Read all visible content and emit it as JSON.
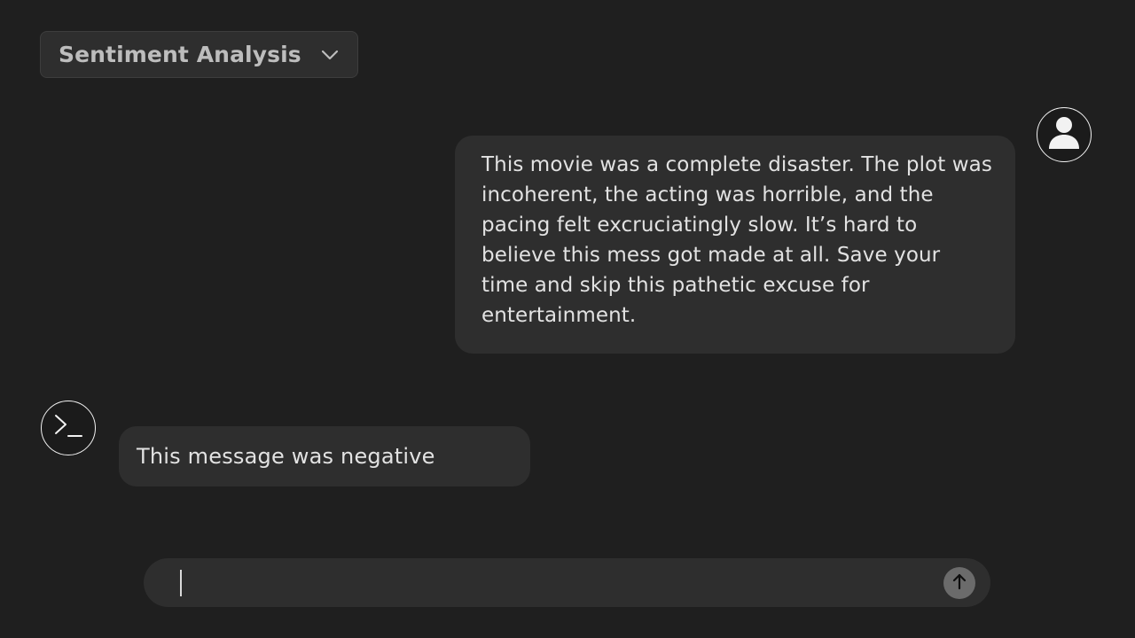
{
  "header": {
    "model_select": {
      "label": "Sentiment Analysis",
      "icon": "chevron-down-icon"
    }
  },
  "conversation": {
    "messages": [
      {
        "role": "user",
        "avatar_icon": "user-icon",
        "text": "This movie was a complete disaster. The plot was incoherent, the acting was horrible, and the pacing felt excruciatingly slow. It’s hard to believe this mess got made at all. Save your time and skip this pathetic excuse for entertainment."
      },
      {
        "role": "assistant",
        "avatar_icon": "terminal-icon",
        "text": "This message was negative"
      }
    ]
  },
  "composer": {
    "value": "",
    "placeholder": "",
    "send_icon": "arrow-up-icon"
  },
  "colors": {
    "background": "#1f1f1f",
    "bubble": "#2e2e2e",
    "send_button": "#6b6b6b",
    "text": "#e2e2e2"
  }
}
